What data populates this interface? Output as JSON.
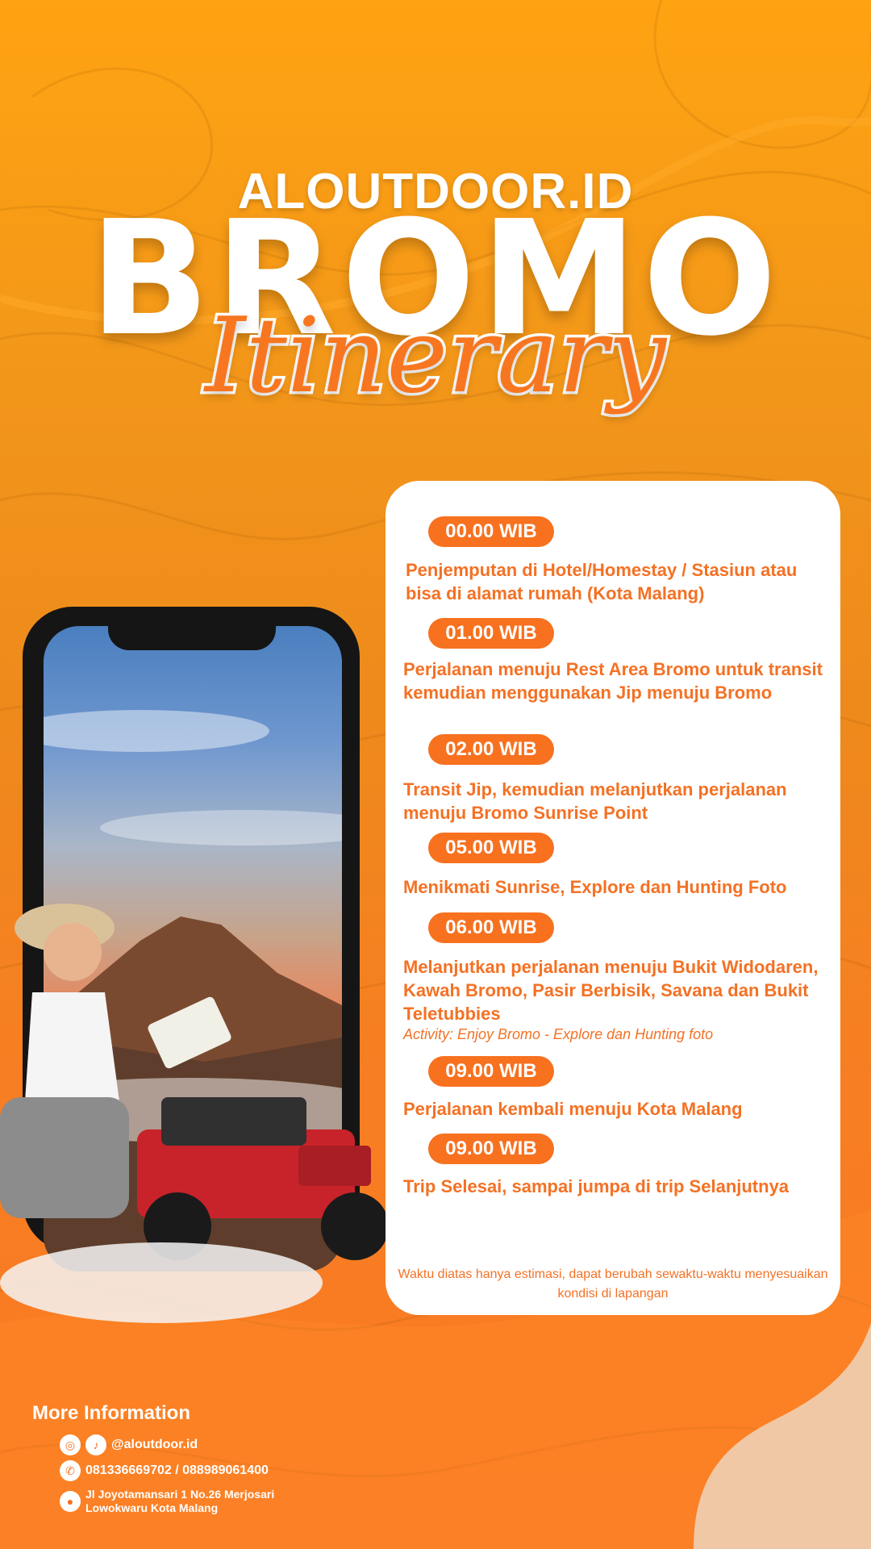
{
  "header": {
    "brand": "ALOUTDOOR.ID",
    "title": "BROMO",
    "subtitle": "Itinerary"
  },
  "schedule": [
    {
      "time": "00.00 WIB",
      "description": "Penjemputan di Hotel/Homestay / Stasiun atau bisa di alamat rumah (Kota Malang)"
    },
    {
      "time": "01.00 WIB",
      "description": "Perjalanan menuju Rest Area Bromo untuk transit kemudian menggunakan Jip menuju Bromo"
    },
    {
      "time": "02.00 WIB",
      "description": "Transit Jip, kemudian melanjutkan perjalanan menuju Bromo Sunrise Point"
    },
    {
      "time": "05.00 WIB",
      "description": "Menikmati Sunrise, Explore dan Hunting Foto"
    },
    {
      "time": "06.00 WIB",
      "description": "Melanjutkan perjalanan menuju Bukit Widodaren, Kawah Bromo, Pasir Berbisik, Savana dan Bukit Teletubbies",
      "activity": "Activity: Enjoy Bromo - Explore dan Hunting foto"
    },
    {
      "time": "09.00 WIB",
      "description": "Perjalanan kembali menuju Kota Malang"
    },
    {
      "time": "09.00 WIB",
      "description": "Trip Selesai, sampai jumpa di trip Selanjutnya"
    }
  ],
  "disclaimer": "Waktu diatas hanya estimasi, dapat berubah sewaktu-waktu menyesuaikan kondisi di lapangan",
  "info": {
    "title": "More Information",
    "social": "@aloutdoor.id",
    "phone": "081336669702 / 088989061400",
    "address_line1": "Jl Joyotamansari 1 No.26 Merjosari",
    "address_line2": "Lowokwaru Kota Malang"
  },
  "colors": {
    "accent": "#f7711f",
    "background": "#f39a19",
    "card": "#ffffff"
  }
}
